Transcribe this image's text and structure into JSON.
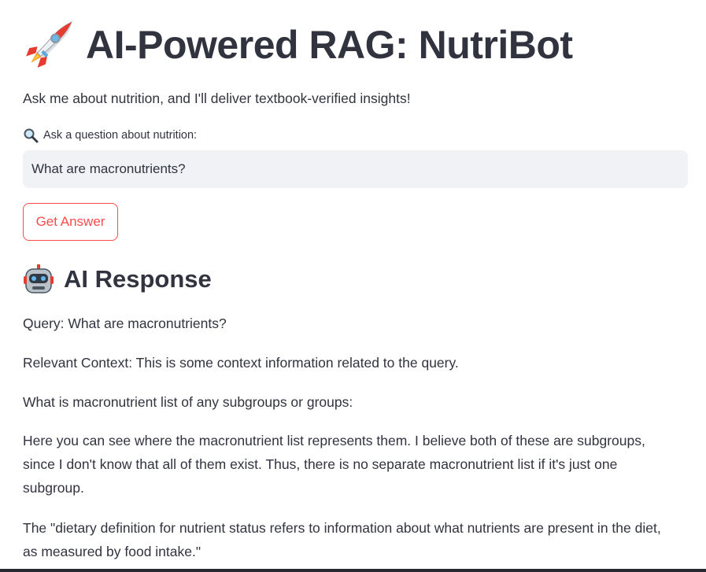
{
  "header": {
    "title": "AI-Powered RAG: NutriBot",
    "title_icon": "rocket-icon"
  },
  "intro": {
    "text": "Ask me about nutrition, and I'll deliver textbook-verified insights!"
  },
  "question": {
    "label": "Ask a question about nutrition:",
    "label_icon": "magnifying-glass-icon",
    "value": "What are macronutrients?"
  },
  "actions": {
    "get_answer_label": "Get Answer"
  },
  "response": {
    "heading": "AI Response",
    "heading_icon": "robot-icon",
    "paragraphs": [
      "Query: What are macronutrients?",
      "Relevant Context: This is some context information related to the query.",
      "What is macronutrient list of any subgroups or groups:",
      "Here you can see where the macronutrient list represents them. I believe both of these are subgroups, since I don't know that all of them exist. Thus, there is no separate macronutrient list if it's just one subgroup.",
      "The \"dietary definition for nutrient status refers to information about what nutrients are present in the diet, as measured by food intake.\""
    ]
  },
  "colors": {
    "accent": "#ff4b4b",
    "text": "#31333f",
    "input_bg": "#f0f2f6"
  }
}
